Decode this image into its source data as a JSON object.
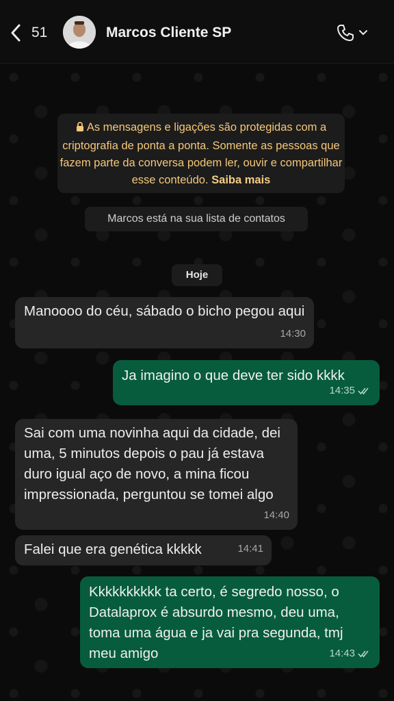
{
  "header": {
    "back_count": "51",
    "contact_name": "Marcos Cliente SP"
  },
  "notice": {
    "text": "As mensagens e ligações são protegidas com a criptografia de ponta a ponta. Somente as pessoas que fazem parte da conversa podem ler, ouvir e compartilhar esse conteúdo.",
    "link": "Saiba mais"
  },
  "system_message": "Marcos está na sua lista de contatos",
  "date_label": "Hoje",
  "messages": [
    {
      "direction": "incoming",
      "text": "Manoooo do céu, sábado o bicho pegou aqui",
      "time": "14:30"
    },
    {
      "direction": "outgoing",
      "text": "Ja imagino o que deve ter sido kkkk",
      "time": "14:35",
      "status": "read"
    },
    {
      "direction": "incoming",
      "text": "Sai com uma novinha aqui da cidade, dei uma, 5 minutos depois o pau já estava duro igual aço de novo, a mina ficou impressionada, perguntou se tomei algo",
      "time": "14:40"
    },
    {
      "direction": "incoming",
      "text": "Falei que era genética kkkkk",
      "time": "14:41"
    },
    {
      "direction": "outgoing",
      "text": "Kkkkkkkkkk ta certo, é segredo nosso, o Datalaprox é absurdo mesmo, deu uma, toma uma água e ja vai pra segunda, tmj meu amigo",
      "time": "14:43",
      "status": "read"
    }
  ],
  "colors": {
    "incoming_bubble": "#262626",
    "outgoing_bubble": "#075c3e",
    "notice_text": "#f5c778"
  }
}
